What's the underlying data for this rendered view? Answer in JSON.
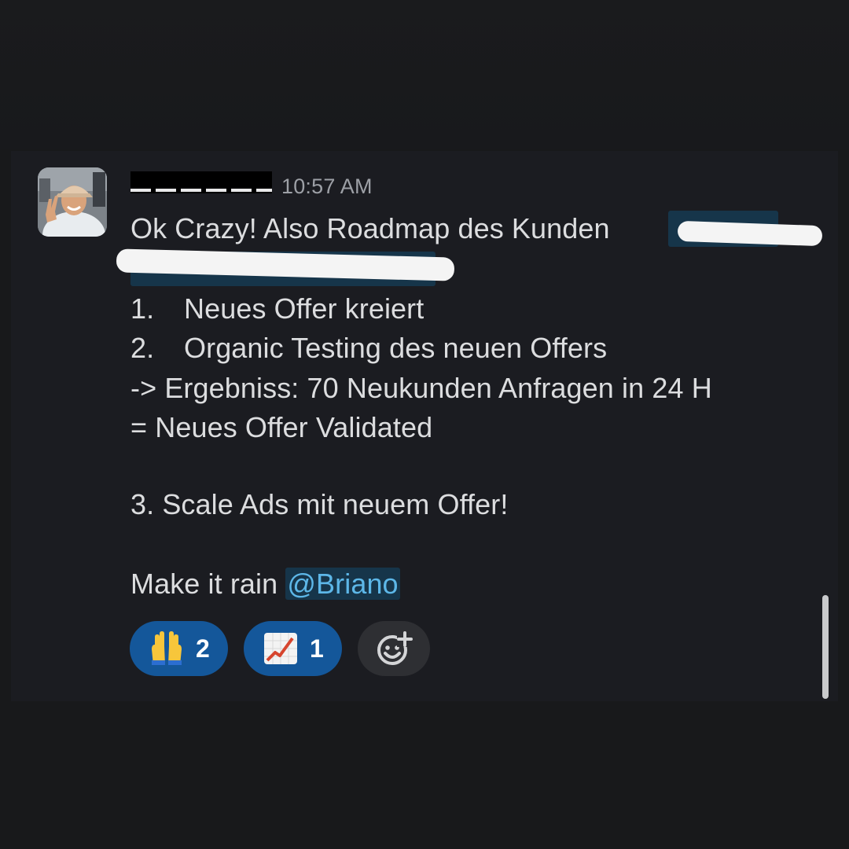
{
  "message": {
    "timestamp": "10:57 AM",
    "line1": "Ok Crazy! Also Roadmap des Kunden",
    "items": [
      {
        "num": "1.",
        "text": "Neues Offer kreiert"
      },
      {
        "num": "2.",
        "text": "Organic Testing des neuen Offers"
      }
    ],
    "result_line": "-> Ergebniss: 70 Neukunden Anfragen in 24 H",
    "validated_line": "= Neues Offer Validated",
    "step3": "3. Scale Ads mit neuem Offer!",
    "closing": "Make it rain",
    "mention": "@Briano"
  },
  "reactions": [
    {
      "emoji": "raising-hands-icon",
      "count": "2"
    },
    {
      "emoji": "chart-increasing-icon",
      "count": "1"
    }
  ],
  "colors": {
    "background": "#18191b",
    "panel": "#1b1c21",
    "text": "#dcdddf",
    "timestamp": "#9da0a6",
    "mention_text": "#5db7e8",
    "mention_bg": "#16354a",
    "reaction_bg": "#14579a",
    "add_reaction_bg": "#2e2f33"
  }
}
